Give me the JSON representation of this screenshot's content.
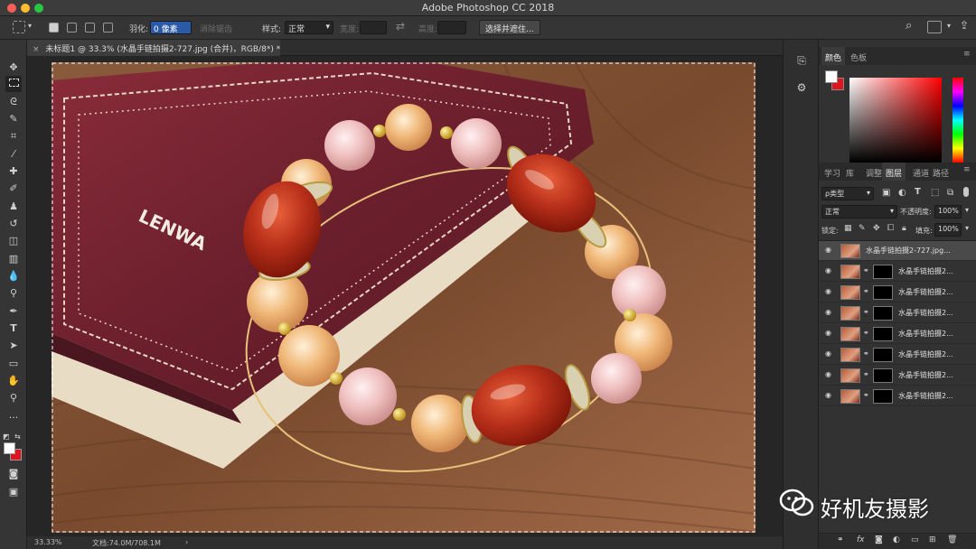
{
  "window": {
    "title": "Adobe Photoshop CC 2018"
  },
  "options_bar": {
    "feather_label": "羽化:",
    "feather_value": "0 像素",
    "antialias_label": "消除锯齿",
    "style_label": "样式:",
    "style_value": "正常",
    "width_label": "宽度:",
    "height_label": "高度:",
    "select_mask_button": "选择并遮住..."
  },
  "document_tab": {
    "label": "未标题1 @ 33.3% (水晶手链拍摄2-727.jpg (合并)，RGB/8*) *",
    "close": "×"
  },
  "photo": {
    "brand_text": "LENWA"
  },
  "status_bar": {
    "zoom": "33.33%",
    "doc_size": "文档:74.0M/708.1M"
  },
  "color_panel": {
    "tabs": [
      "颜色",
      "色板"
    ],
    "foreground": "#ffffff",
    "background": "#e0141e"
  },
  "layers_panel": {
    "tabs": [
      "学习",
      "库",
      "调整",
      "图层",
      "通道",
      "路径"
    ],
    "active_tab": "图层",
    "filter_kind": "ρ类型",
    "blend_mode": "正常",
    "opacity_label": "不透明度:",
    "opacity_value": "100%",
    "lock_label": "锁定:",
    "fill_label": "填充:",
    "fill_value": "100%",
    "layers": [
      {
        "name": "水晶手链拍摄2-727.jpg...",
        "has_mask": false,
        "selected": true
      },
      {
        "name": "水晶手链拍摄2...",
        "has_mask": true,
        "selected": false
      },
      {
        "name": "水晶手链拍摄2...",
        "has_mask": true,
        "selected": false
      },
      {
        "name": "水晶手链拍摄2...",
        "has_mask": true,
        "selected": false
      },
      {
        "name": "水晶手链拍摄2...",
        "has_mask": true,
        "selected": false
      },
      {
        "name": "水晶手链拍摄2...",
        "has_mask": true,
        "selected": false
      },
      {
        "name": "水晶手链拍摄2...",
        "has_mask": true,
        "selected": false
      },
      {
        "name": "水晶手链拍摄2...",
        "has_mask": true,
        "selected": false
      }
    ],
    "bottom_icons": [
      "link-icon",
      "fx-icon",
      "mask-icon",
      "adjustment-icon",
      "folder-icon",
      "new-layer-icon",
      "trash-icon"
    ]
  },
  "watermark": {
    "text": "好机友摄影"
  }
}
